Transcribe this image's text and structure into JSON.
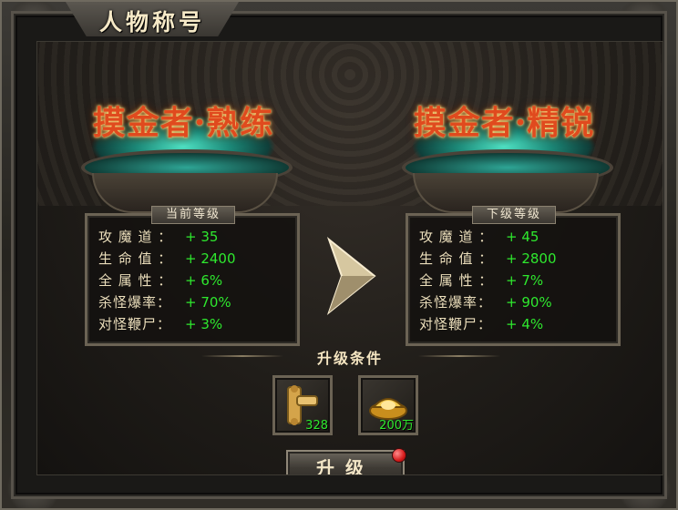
{
  "window": {
    "title": "人物称号"
  },
  "current": {
    "name": "摸金者·熟练",
    "label": "当前等级",
    "stats": [
      {
        "key": "攻 魔 道 ：",
        "value": "+ 35"
      },
      {
        "key": "生 命 值 ：",
        "value": "+ 2400"
      },
      {
        "key": "全 属 性 ：",
        "value": "+ 6%"
      },
      {
        "key": "杀怪爆率：",
        "value": "+ 70%"
      },
      {
        "key": "对怪鞭尸：",
        "value": "+ 3%"
      }
    ]
  },
  "next": {
    "name": "摸金者·精锐",
    "label": "下级等级",
    "stats": [
      {
        "key": "攻 魔 道 ：",
        "value": "+ 45"
      },
      {
        "key": "生 命 值 ：",
        "value": "+ 2800"
      },
      {
        "key": "全 属 性 ：",
        "value": "+ 7%"
      },
      {
        "key": "杀怪爆率：",
        "value": "+ 90%"
      },
      {
        "key": "对怪鞭尸：",
        "value": "+ 4%"
      }
    ]
  },
  "upgrade": {
    "conditions_label": "升级条件",
    "items": [
      {
        "icon": "scroll-icon",
        "count": "328"
      },
      {
        "icon": "gold-ingot-icon",
        "count": "200万"
      }
    ],
    "button_label": "升级",
    "badge_color": "#d51a1a"
  },
  "colors": {
    "title_red": "#e04a1e",
    "stat_green": "#2ee82e",
    "bowl_teal": "#2ea595"
  }
}
